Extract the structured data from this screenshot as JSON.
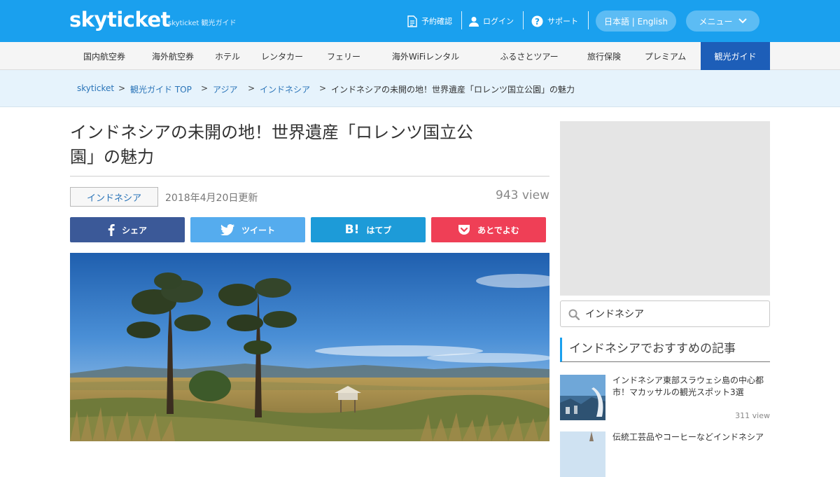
{
  "header": {
    "logo": "skyticket",
    "logo_sub": "skyticket 観光ガイド",
    "links": [
      {
        "label": "予約確認",
        "icon": "document-icon"
      },
      {
        "label": "ログイン",
        "icon": "user-icon"
      },
      {
        "label": "サポート",
        "icon": "question-icon"
      }
    ],
    "language": "日本語 | English",
    "menu": "メニュー"
  },
  "nav": {
    "items": [
      "国内航空券",
      "海外航空券",
      "ホテル",
      "レンタカー",
      "フェリー",
      "海外WiFiレンタル",
      "ふるさとツアー",
      "旅行保険",
      "プレミアム",
      "観光ガイド"
    ],
    "active_index": 9
  },
  "breadcrumb": {
    "items": [
      "skyticket",
      "観光ガイド TOP",
      "アジア",
      "インドネシア",
      "インドネシアの未開の地！世界遺産「ロレンツ国立公園」の魅力"
    ],
    "separator": ">"
  },
  "article": {
    "title_line1": "インドネシアの未開の地！世界遺産「ロレンツ国立公",
    "title_line2": "園」の魅力",
    "tag": "インドネシア",
    "updated": "2018年4月20日更新",
    "views": "943 view"
  },
  "share": {
    "facebook": "シェア",
    "twitter": "ツイート",
    "hatena": "はてブ",
    "hatena_logo": "B!",
    "pocket": "あとでよむ"
  },
  "colors": {
    "header": "#1aa0ee",
    "nav_active": "#1d5eb8",
    "facebook": "#3b5998",
    "twitter": "#55acee",
    "hatena": "#1d9bd8",
    "pocket": "#ef3f56"
  },
  "sidebar": {
    "search_value": "インドネシア",
    "heading": "インドネシアでおすすめの記事",
    "articles": [
      {
        "title": "インドネシア東部スラウェシ島の中心都市！マカッサルの観光スポット3選",
        "views": "311 view"
      },
      {
        "title": "伝統工芸品やコーヒーなどインドネシア",
        "views": ""
      }
    ]
  }
}
